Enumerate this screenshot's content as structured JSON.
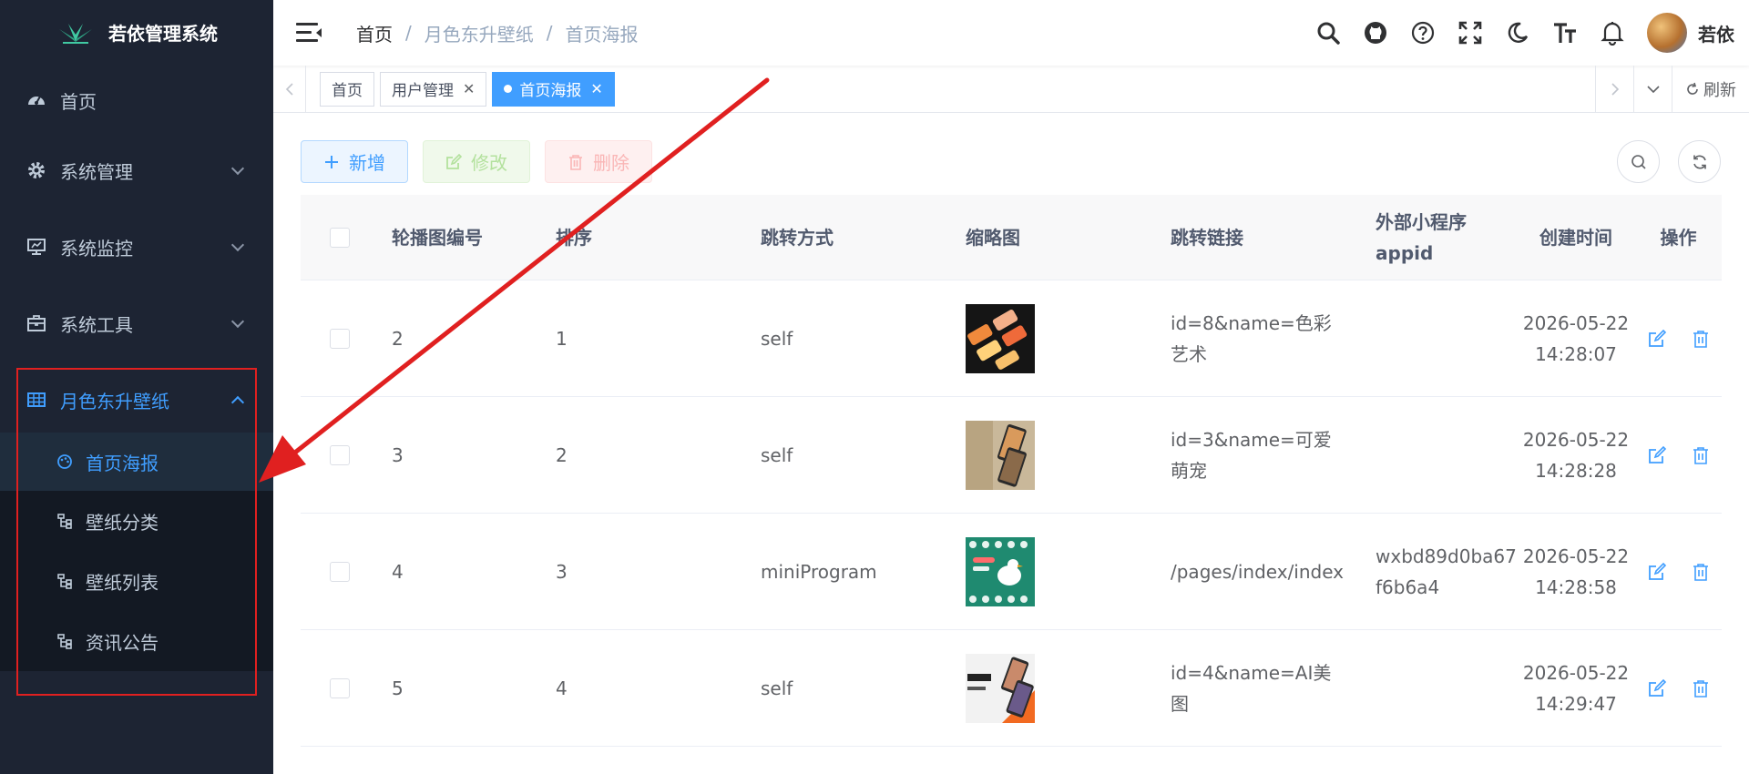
{
  "app": {
    "title": "若依管理系统"
  },
  "sidebar": {
    "items": [
      {
        "label": "首页"
      },
      {
        "label": "系统管理"
      },
      {
        "label": "系统监控"
      },
      {
        "label": "系统工具"
      },
      {
        "label": "月色东升壁纸"
      }
    ],
    "submenu": [
      {
        "label": "首页海报",
        "active": true
      },
      {
        "label": "壁纸分类"
      },
      {
        "label": "壁纸列表"
      },
      {
        "label": "资讯公告"
      }
    ]
  },
  "navbar": {
    "breadcrumb": [
      "首页",
      "月色东升壁纸",
      "首页海报"
    ],
    "breadcrumb_sep": "/",
    "user": "若依"
  },
  "tags": {
    "items": [
      {
        "label": "首页"
      },
      {
        "label": "用户管理",
        "close": "✕"
      },
      {
        "label": "首页海报",
        "close": "✕",
        "active": true
      }
    ],
    "refresh_label": "刷新"
  },
  "toolbar": {
    "add": "新增",
    "edit": "修改",
    "delete": "删除"
  },
  "table": {
    "headers": [
      "轮播图编号",
      "排序",
      "跳转方式",
      "缩略图",
      "跳转链接",
      "外部小程序appid",
      "创建时间",
      "操作"
    ],
    "rows": [
      {
        "id": "2",
        "sort": "1",
        "jump": "self",
        "link": "id=8&name=色彩艺术",
        "appid": "",
        "created": "2026-05-22 14:28:07"
      },
      {
        "id": "3",
        "sort": "2",
        "jump": "self",
        "link": "id=3&name=可爱萌宠",
        "appid": "",
        "created": "2026-05-22 14:28:28"
      },
      {
        "id": "4",
        "sort": "3",
        "jump": "miniProgram",
        "link": "/pages/index/index",
        "appid": "wxbd89d0ba67f6b6a4",
        "created": "2026-05-22 14:28:58"
      },
      {
        "id": "5",
        "sort": "4",
        "jump": "self",
        "link": "id=4&name=AI美图",
        "appid": "",
        "created": "2026-05-22 14:29:47"
      }
    ]
  },
  "colors": {
    "primary": "#409eff",
    "sidebar_bg": "#1d2433",
    "annotation": "#e02020"
  }
}
